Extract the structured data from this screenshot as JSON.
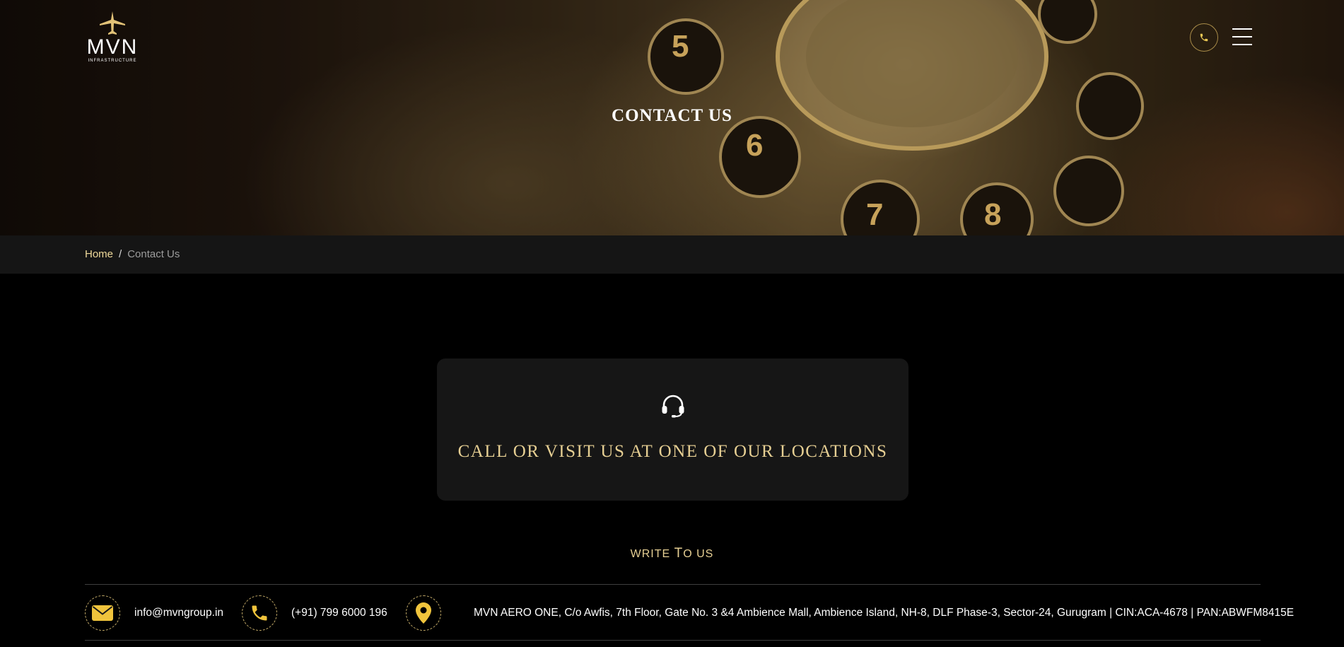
{
  "header": {
    "logo": {
      "brand": "MVN",
      "tagline": "INFRASTRUCTURE"
    },
    "phone_icon": "phone-icon",
    "menu_icon": "hamburger-menu-icon"
  },
  "hero": {
    "title": "CONTACT US"
  },
  "breadcrumb": {
    "home": "Home",
    "separator": "/",
    "current": "Contact Us"
  },
  "card": {
    "icon": "headset-icon",
    "title": "CALL OR VISIT US AT ONE OF OUR LOCATIONS"
  },
  "write": {
    "first": "WRITE ",
    "big": "T",
    "rest": "O US"
  },
  "contact": {
    "email": "info@mvngroup.in",
    "phone": "(+91) 799 6000 196",
    "address": "MVN AERO ONE, C/o Awfis, 7th Floor, Gate No. 3 &4 Ambience Mall, Ambience Island, NH-8, DLF Phase-3, Sector-24, Gurugram | CIN:ACA-4678 | PAN:ABWFM8415E"
  },
  "colors": {
    "gold": "#e6cf93",
    "accent": "#efd99a",
    "icon_gold": "#f0c43c",
    "background": "#000000",
    "panel": "#161616"
  }
}
